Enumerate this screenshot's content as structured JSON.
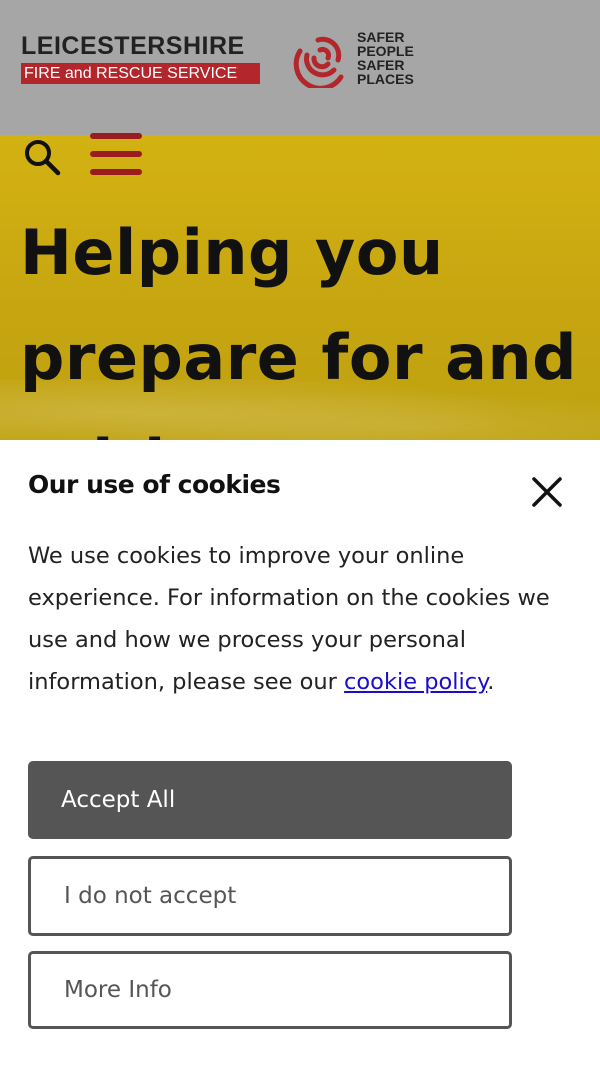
{
  "header": {
    "brand_line1": "LEICESTERSHIRE",
    "brand_line2": "FIRE and RESCUE SERVICE",
    "slogan": [
      "SAFER",
      "PEOPLE",
      "SAFER",
      "PLACES"
    ],
    "icons": {
      "search": "search-icon",
      "menu": "menu-icon",
      "logo": "signal-waves-logo"
    },
    "colors": {
      "brand_red": "#b3262b",
      "menu_red": "#9b1c1f",
      "header_bg": "#a6a6a6"
    }
  },
  "hero": {
    "title_line1": "Helping you",
    "title_line2": "prepare for and",
    "title_line3": "...ith",
    "bg_color": "#d9b814"
  },
  "cookie_banner": {
    "title": "Our use of cookies",
    "body_text": "We use cookies to improve your online experience. For information on the cookies we use and how we process your personal information, please see our ",
    "link_text": "cookie policy",
    "body_end": ".",
    "accept_label": "Accept All",
    "decline_label": "I do not accept",
    "more_label": "More Info",
    "close_icon": "close-icon",
    "accent_button": "#555555",
    "link_color": "#1a0dcc"
  }
}
